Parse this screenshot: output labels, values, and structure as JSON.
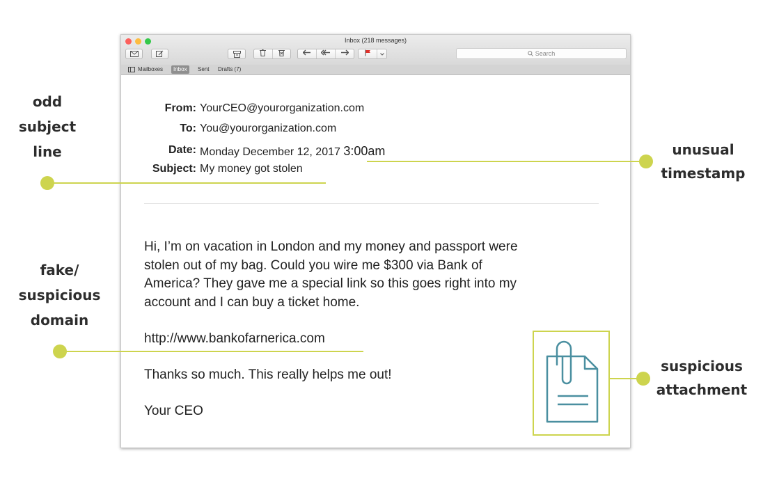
{
  "window": {
    "title": "Inbox (218 messages)",
    "search_placeholder": "Search",
    "favorites": [
      "Mailboxes",
      "Inbox",
      "Sent",
      "Drafts (7)"
    ]
  },
  "email": {
    "from_label": "From:",
    "from_value": "YourCEO@yourorganization.com",
    "to_label": "To:",
    "to_value": "You@yourorganization.com",
    "date_label": "Date:",
    "date_value": "Monday December 12, 2017",
    "time_value": "3:00am",
    "subject_label": "Subject:",
    "subject_value": "My money got stolen",
    "body_lines": [
      "Hi, I’m on vacation in London and my money and passport were",
      "stolen out of my bag. Could you wire me $300 via Bank of",
      "America? They gave me a special link so this goes right into my",
      "account and I can buy a ticket home."
    ],
    "link": "http://www.bankofarnerica.com",
    "thanks": "Thanks so much. This really helps me out!",
    "signature": "Your CEO"
  },
  "annotations": {
    "odd_subject": [
      "odd",
      "subject",
      "line"
    ],
    "fake_domain": [
      "fake/",
      "suspicious",
      "domain"
    ],
    "unusual_timestamp": [
      "unusual",
      "timestamp"
    ],
    "suspicious_attachment": [
      "suspicious",
      "attachment"
    ]
  },
  "colors": {
    "accent": "#cdd44e",
    "attachment_icon": "#4a8fa0",
    "close": "#fc605c",
    "minimize": "#fdbc40",
    "zoom": "#34c84a"
  },
  "icons": [
    "compose-mail-icon",
    "new-message-icon",
    "archive-icon",
    "trash-icon",
    "junk-icon",
    "reply-icon",
    "reply-all-icon",
    "forward-icon",
    "flag-icon",
    "chevron-down-icon",
    "search-icon",
    "sidebar-icon",
    "paperclip-document-icon"
  ]
}
